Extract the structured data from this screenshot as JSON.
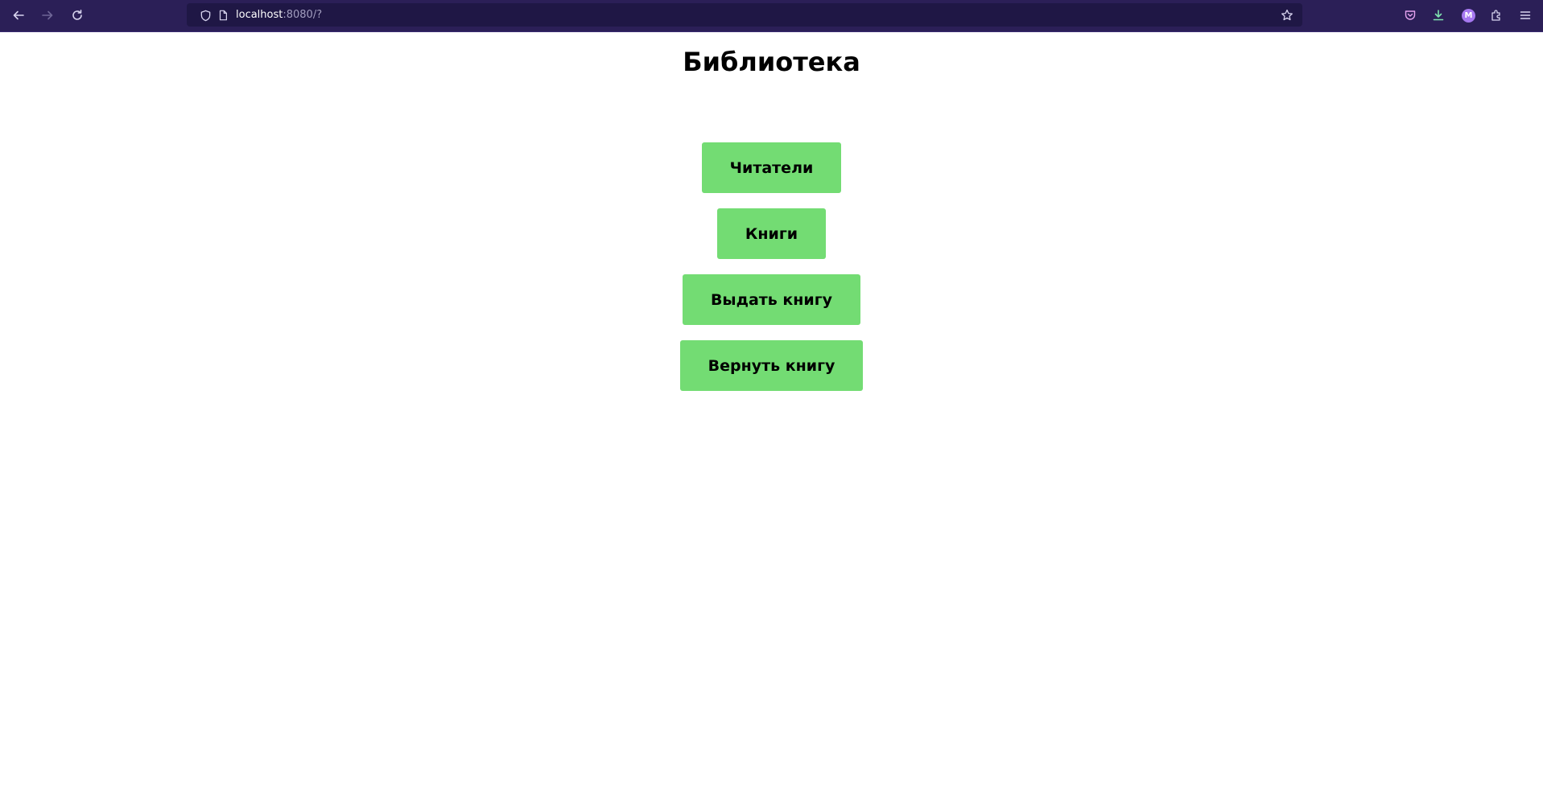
{
  "browser": {
    "url_host": "localhost",
    "url_rest": ":8080/?",
    "profile_initial": "M",
    "icons": [
      "back-arrow-icon",
      "forward-arrow-icon",
      "reload-icon",
      "shield-icon",
      "page-icon",
      "star-icon",
      "pocket-icon",
      "download-icon",
      "extensions-icon",
      "hamburger-menu-icon"
    ],
    "colors": {
      "toolbar": "#2b1f57",
      "urlbar": "#1f1745",
      "accent": "#a678f0"
    }
  },
  "page": {
    "title": "Библиотека",
    "buttons": [
      {
        "label": "Читатели"
      },
      {
        "label": "Книги"
      },
      {
        "label": "Выдать книгу"
      },
      {
        "label": "Вернуть книгу"
      }
    ],
    "colors": {
      "button_bg": "#73dc73",
      "button_text": "#000000"
    }
  }
}
